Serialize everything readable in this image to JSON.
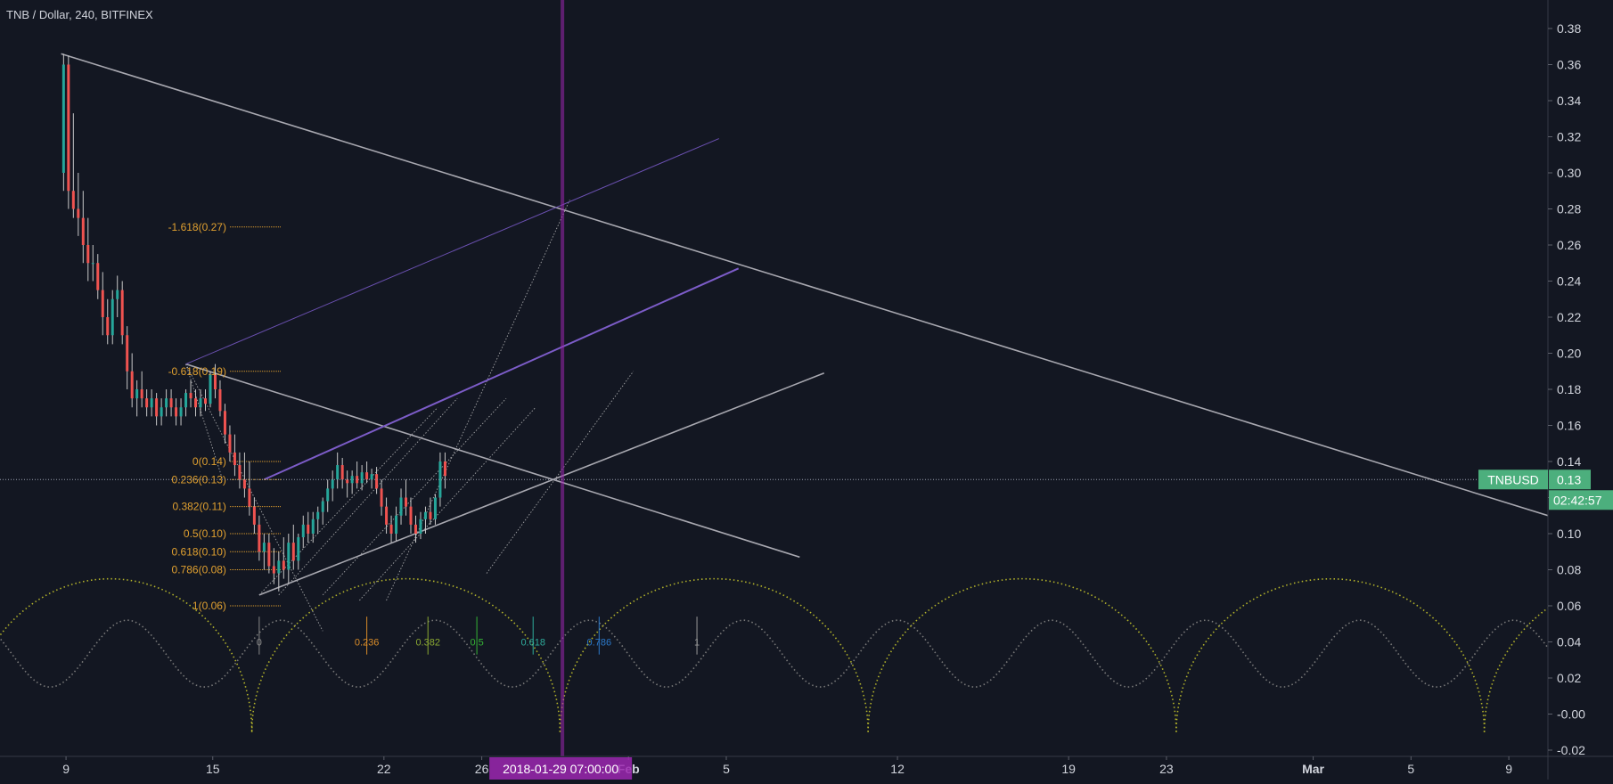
{
  "chart_data": {
    "type": "candlestick",
    "title": "TNB / Dollar, 240, BITFINEX",
    "symbol": "TNBUSD",
    "last_price": "0.13",
    "countdown": "02:42:57",
    "crosshair_date_label": "2018-01-29 07:00:00",
    "x_axis_ticks": [
      {
        "label": "9",
        "day": 9,
        "bold": false
      },
      {
        "label": "15",
        "day": 15,
        "bold": false
      },
      {
        "label": "22",
        "day": 22,
        "bold": false
      },
      {
        "label": "26",
        "day": 26,
        "bold": false
      },
      {
        "label": "Feb",
        "day": 32,
        "bold": true
      },
      {
        "label": "5",
        "day": 36,
        "bold": false
      },
      {
        "label": "12",
        "day": 43,
        "bold": false
      },
      {
        "label": "19",
        "day": 50,
        "bold": false
      },
      {
        "label": "23",
        "day": 54,
        "bold": false
      },
      {
        "label": "Mar",
        "day": 60,
        "bold": true
      },
      {
        "label": "5",
        "day": 64,
        "bold": false
      },
      {
        "label": "9",
        "day": 68,
        "bold": false
      }
    ],
    "y_axis_ticks": [
      "0.38",
      "0.36",
      "0.34",
      "0.32",
      "0.30",
      "0.28",
      "0.26",
      "0.24",
      "0.22",
      "0.20",
      "0.18",
      "0.16",
      "0.14",
      "0.12",
      "0.10",
      "0.08",
      "0.06",
      "0.04",
      "0.02",
      "-0.00",
      "-0.02"
    ],
    "y_tick_values": [
      0.38,
      0.36,
      0.34,
      0.32,
      0.3,
      0.28,
      0.26,
      0.24,
      0.22,
      0.2,
      0.18,
      0.16,
      0.14,
      0.12,
      0.1,
      0.08,
      0.06,
      0.04,
      0.02,
      0.0,
      -0.02
    ],
    "ylim": [
      -0.024,
      0.39
    ],
    "xlim": [
      6.3,
      69.6
    ],
    "crosshair": {
      "day": 29.3,
      "price": 0.13
    },
    "candles": [
      {
        "d": 8.9,
        "o": 0.3,
        "h": 0.366,
        "l": 0.29,
        "c": 0.36
      },
      {
        "d": 9.1,
        "o": 0.36,
        "h": 0.365,
        "l": 0.28,
        "c": 0.29
      },
      {
        "d": 9.3,
        "o": 0.29,
        "h": 0.333,
        "l": 0.275,
        "c": 0.28
      },
      {
        "d": 9.5,
        "o": 0.28,
        "h": 0.3,
        "l": 0.265,
        "c": 0.275
      },
      {
        "d": 9.7,
        "o": 0.275,
        "h": 0.29,
        "l": 0.25,
        "c": 0.26
      },
      {
        "d": 9.9,
        "o": 0.26,
        "h": 0.275,
        "l": 0.24,
        "c": 0.25
      },
      {
        "d": 10.1,
        "o": 0.25,
        "h": 0.26,
        "l": 0.24,
        "c": 0.25
      },
      {
        "d": 10.3,
        "o": 0.25,
        "h": 0.255,
        "l": 0.23,
        "c": 0.235
      },
      {
        "d": 10.5,
        "o": 0.235,
        "h": 0.245,
        "l": 0.21,
        "c": 0.22
      },
      {
        "d": 10.7,
        "o": 0.22,
        "h": 0.23,
        "l": 0.205,
        "c": 0.21
      },
      {
        "d": 10.9,
        "o": 0.21,
        "h": 0.235,
        "l": 0.205,
        "c": 0.23
      },
      {
        "d": 11.1,
        "o": 0.23,
        "h": 0.243,
        "l": 0.22,
        "c": 0.235
      },
      {
        "d": 11.3,
        "o": 0.235,
        "h": 0.24,
        "l": 0.205,
        "c": 0.21
      },
      {
        "d": 11.5,
        "o": 0.21,
        "h": 0.215,
        "l": 0.18,
        "c": 0.19
      },
      {
        "d": 11.7,
        "o": 0.19,
        "h": 0.2,
        "l": 0.17,
        "c": 0.175
      },
      {
        "d": 11.9,
        "o": 0.175,
        "h": 0.185,
        "l": 0.165,
        "c": 0.18
      },
      {
        "d": 12.1,
        "o": 0.18,
        "h": 0.19,
        "l": 0.17,
        "c": 0.175
      },
      {
        "d": 12.3,
        "o": 0.175,
        "h": 0.18,
        "l": 0.165,
        "c": 0.17
      },
      {
        "d": 12.5,
        "o": 0.17,
        "h": 0.18,
        "l": 0.165,
        "c": 0.175
      },
      {
        "d": 12.7,
        "o": 0.175,
        "h": 0.178,
        "l": 0.16,
        "c": 0.165
      },
      {
        "d": 12.9,
        "o": 0.165,
        "h": 0.175,
        "l": 0.16,
        "c": 0.17
      },
      {
        "d": 13.1,
        "o": 0.17,
        "h": 0.18,
        "l": 0.165,
        "c": 0.175
      },
      {
        "d": 13.3,
        "o": 0.175,
        "h": 0.18,
        "l": 0.165,
        "c": 0.17
      },
      {
        "d": 13.5,
        "o": 0.17,
        "h": 0.175,
        "l": 0.16,
        "c": 0.165
      },
      {
        "d": 13.7,
        "o": 0.165,
        "h": 0.175,
        "l": 0.16,
        "c": 0.17
      },
      {
        "d": 13.9,
        "o": 0.17,
        "h": 0.18,
        "l": 0.165,
        "c": 0.178
      },
      {
        "d": 14.1,
        "o": 0.178,
        "h": 0.185,
        "l": 0.17,
        "c": 0.175
      },
      {
        "d": 14.3,
        "o": 0.175,
        "h": 0.18,
        "l": 0.165,
        "c": 0.17
      },
      {
        "d": 14.5,
        "o": 0.17,
        "h": 0.18,
        "l": 0.165,
        "c": 0.175
      },
      {
        "d": 14.7,
        "o": 0.175,
        "h": 0.18,
        "l": 0.168,
        "c": 0.172
      },
      {
        "d": 14.9,
        "o": 0.172,
        "h": 0.19,
        "l": 0.17,
        "c": 0.188
      },
      {
        "d": 15.1,
        "o": 0.188,
        "h": 0.194,
        "l": 0.175,
        "c": 0.18
      },
      {
        "d": 15.3,
        "o": 0.18,
        "h": 0.185,
        "l": 0.165,
        "c": 0.168
      },
      {
        "d": 15.5,
        "o": 0.168,
        "h": 0.172,
        "l": 0.15,
        "c": 0.155
      },
      {
        "d": 15.7,
        "o": 0.155,
        "h": 0.16,
        "l": 0.14,
        "c": 0.145
      },
      {
        "d": 15.9,
        "o": 0.145,
        "h": 0.155,
        "l": 0.132,
        "c": 0.138
      },
      {
        "d": 16.1,
        "o": 0.138,
        "h": 0.145,
        "l": 0.125,
        "c": 0.13
      },
      {
        "d": 16.3,
        "o": 0.13,
        "h": 0.145,
        "l": 0.12,
        "c": 0.125
      },
      {
        "d": 16.5,
        "o": 0.125,
        "h": 0.14,
        "l": 0.11,
        "c": 0.115
      },
      {
        "d": 16.7,
        "o": 0.115,
        "h": 0.12,
        "l": 0.1,
        "c": 0.105
      },
      {
        "d": 16.9,
        "o": 0.105,
        "h": 0.11,
        "l": 0.085,
        "c": 0.09
      },
      {
        "d": 17.1,
        "o": 0.09,
        "h": 0.1,
        "l": 0.08,
        "c": 0.095
      },
      {
        "d": 17.3,
        "o": 0.095,
        "h": 0.1,
        "l": 0.078,
        "c": 0.082
      },
      {
        "d": 17.5,
        "o": 0.082,
        "h": 0.092,
        "l": 0.072,
        "c": 0.078
      },
      {
        "d": 17.7,
        "o": 0.078,
        "h": 0.09,
        "l": 0.068,
        "c": 0.085
      },
      {
        "d": 17.9,
        "o": 0.085,
        "h": 0.098,
        "l": 0.075,
        "c": 0.08
      },
      {
        "d": 18.1,
        "o": 0.08,
        "h": 0.1,
        "l": 0.072,
        "c": 0.095
      },
      {
        "d": 18.3,
        "o": 0.095,
        "h": 0.105,
        "l": 0.08,
        "c": 0.085
      },
      {
        "d": 18.5,
        "o": 0.085,
        "h": 0.1,
        "l": 0.08,
        "c": 0.098
      },
      {
        "d": 18.7,
        "o": 0.098,
        "h": 0.11,
        "l": 0.092,
        "c": 0.105
      },
      {
        "d": 18.9,
        "o": 0.105,
        "h": 0.112,
        "l": 0.095,
        "c": 0.1
      },
      {
        "d": 19.1,
        "o": 0.1,
        "h": 0.112,
        "l": 0.095,
        "c": 0.108
      },
      {
        "d": 19.3,
        "o": 0.108,
        "h": 0.115,
        "l": 0.1,
        "c": 0.112
      },
      {
        "d": 19.5,
        "o": 0.112,
        "h": 0.12,
        "l": 0.105,
        "c": 0.118
      },
      {
        "d": 19.7,
        "o": 0.118,
        "h": 0.13,
        "l": 0.112,
        "c": 0.125
      },
      {
        "d": 19.9,
        "o": 0.125,
        "h": 0.135,
        "l": 0.118,
        "c": 0.13
      },
      {
        "d": 20.1,
        "o": 0.13,
        "h": 0.145,
        "l": 0.125,
        "c": 0.138
      },
      {
        "d": 20.3,
        "o": 0.138,
        "h": 0.142,
        "l": 0.125,
        "c": 0.13
      },
      {
        "d": 20.5,
        "o": 0.13,
        "h": 0.135,
        "l": 0.12,
        "c": 0.128
      },
      {
        "d": 20.7,
        "o": 0.128,
        "h": 0.135,
        "l": 0.122,
        "c": 0.132
      },
      {
        "d": 20.9,
        "o": 0.132,
        "h": 0.14,
        "l": 0.125,
        "c": 0.128
      },
      {
        "d": 21.1,
        "o": 0.128,
        "h": 0.138,
        "l": 0.124,
        "c": 0.134
      },
      {
        "d": 21.3,
        "o": 0.134,
        "h": 0.14,
        "l": 0.128,
        "c": 0.13
      },
      {
        "d": 21.5,
        "o": 0.13,
        "h": 0.136,
        "l": 0.125,
        "c": 0.133
      },
      {
        "d": 21.7,
        "o": 0.133,
        "h": 0.137,
        "l": 0.122,
        "c": 0.125
      },
      {
        "d": 21.9,
        "o": 0.125,
        "h": 0.13,
        "l": 0.11,
        "c": 0.115
      },
      {
        "d": 22.1,
        "o": 0.115,
        "h": 0.12,
        "l": 0.1,
        "c": 0.105
      },
      {
        "d": 22.3,
        "o": 0.105,
        "h": 0.11,
        "l": 0.095,
        "c": 0.1
      },
      {
        "d": 22.5,
        "o": 0.1,
        "h": 0.115,
        "l": 0.096,
        "c": 0.11
      },
      {
        "d": 22.7,
        "o": 0.11,
        "h": 0.125,
        "l": 0.105,
        "c": 0.12
      },
      {
        "d": 22.9,
        "o": 0.12,
        "h": 0.13,
        "l": 0.11,
        "c": 0.115
      },
      {
        "d": 23.1,
        "o": 0.115,
        "h": 0.12,
        "l": 0.1,
        "c": 0.105
      },
      {
        "d": 23.3,
        "o": 0.105,
        "h": 0.11,
        "l": 0.095,
        "c": 0.1
      },
      {
        "d": 23.5,
        "o": 0.1,
        "h": 0.112,
        "l": 0.097,
        "c": 0.108
      },
      {
        "d": 23.7,
        "o": 0.108,
        "h": 0.115,
        "l": 0.1,
        "c": 0.112
      },
      {
        "d": 23.9,
        "o": 0.112,
        "h": 0.12,
        "l": 0.105,
        "c": 0.108
      },
      {
        "d": 24.1,
        "o": 0.108,
        "h": 0.122,
        "l": 0.105,
        "c": 0.12
      },
      {
        "d": 24.3,
        "o": 0.12,
        "h": 0.145,
        "l": 0.115,
        "c": 0.14
      },
      {
        "d": 24.5,
        "o": 0.14,
        "h": 0.145,
        "l": 0.125,
        "c": 0.132
      }
    ],
    "fibonacci_levels": [
      {
        "label": "-1.618(0.27)",
        "price": 0.27
      },
      {
        "label": "-0.618(0.19)",
        "price": 0.19
      },
      {
        "label": "0(0.14)",
        "price": 0.14
      },
      {
        "label": "0.236(0.13)",
        "price": 0.13
      },
      {
        "label": "0.382(0.11)",
        "price": 0.115
      },
      {
        "label": "0.5(0.10)",
        "price": 0.1
      },
      {
        "label": "0.618(0.10)",
        "price": 0.09
      },
      {
        "label": "0.786(0.08)",
        "price": 0.08
      },
      {
        "label": "1(0.06)",
        "price": 0.06
      }
    ],
    "fib_time_zones": [
      {
        "label": "0",
        "day": 16.9,
        "color": "#888888"
      },
      {
        "label": "0.236",
        "day": 21.3,
        "color": "#d98c28"
      },
      {
        "label": "0.382",
        "day": 23.8,
        "color": "#8aa832"
      },
      {
        "label": "0.5",
        "day": 25.8,
        "color": "#35b335"
      },
      {
        "label": "0.618",
        "day": 28.1,
        "color": "#2eaa9a"
      },
      {
        "label": "0.786",
        "day": 30.8,
        "color": "#2b78c8"
      },
      {
        "label": "1",
        "day": 34.8,
        "color": "#9a9a9a"
      }
    ],
    "trend_lines": [
      {
        "from": [
          8.8,
          0.366
        ],
        "to": [
          69.6,
          0.11
        ],
        "color": "#a8a8b0",
        "style": "solid"
      },
      {
        "from": [
          13.9,
          0.194
        ],
        "to": [
          39.0,
          0.087
        ],
        "color": "#a8a8b0",
        "style": "solid"
      },
      {
        "from": [
          16.9,
          0.066
        ],
        "to": [
          40.0,
          0.189
        ],
        "color": "#a8a8b0",
        "style": "solid"
      },
      {
        "from": [
          17.1,
          0.13
        ],
        "to": [
          36.5,
          0.247
        ],
        "color": "#7c5cc8",
        "style": "solid"
      },
      {
        "from": [
          13.9,
          0.194
        ],
        "to": [
          35.7,
          0.319
        ],
        "color": "#6a50b0",
        "style": "solid"
      }
    ],
    "fan_lines": [
      {
        "from": [
          13.9,
          0.194
        ],
        "to": [
          19.5,
          0.046
        ],
        "color": "#c8c8c8"
      },
      {
        "from": [
          16.9,
          0.066
        ],
        "to": [
          24.2,
          0.17
        ],
        "color": "#c8c8c8"
      },
      {
        "from": [
          17.7,
          0.066
        ],
        "to": [
          25.0,
          0.175
        ],
        "color": "#c8c8c8"
      },
      {
        "from": [
          19.5,
          0.066
        ],
        "to": [
          27.0,
          0.175
        ],
        "color": "#c8c8c8"
      },
      {
        "from": [
          21.0,
          0.063
        ],
        "to": [
          28.2,
          0.17
        ],
        "color": "#c8c8c8"
      },
      {
        "from": [
          22.1,
          0.063
        ],
        "to": [
          29.6,
          0.285
        ],
        "color": "#c8c8c8"
      },
      {
        "from": [
          26.2,
          0.078
        ],
        "to": [
          32.2,
          0.19
        ],
        "color": "#c8c8c8"
      },
      {
        "from": [
          13.9,
          0.194
        ],
        "to": [
          15.4,
          0.13
        ],
        "color": "#c8c8c8"
      }
    ],
    "cycle_arcs": [
      {
        "start": 5.0,
        "end": 16.6,
        "color": "#b3b32a",
        "peak": 0.075
      },
      {
        "start": 16.6,
        "end": 29.2,
        "color": "#b3b32a",
        "peak": 0.075
      },
      {
        "start": 29.2,
        "end": 41.8,
        "color": "#b3b32a",
        "peak": 0.075
      },
      {
        "start": 41.8,
        "end": 54.4,
        "color": "#b3b32a",
        "peak": 0.075
      },
      {
        "start": 54.4,
        "end": 67.0,
        "color": "#b3b32a",
        "peak": 0.075
      },
      {
        "start": 67.0,
        "end": 79.6,
        "color": "#b3b32a",
        "peak": 0.075
      }
    ],
    "sine_cycle": {
      "period": 6.3,
      "phase_day": 8.35,
      "low": 0.015,
      "high": 0.052,
      "color": "#7a7a7a"
    },
    "colors": {
      "background": "#131722",
      "up": "#26a69a",
      "down": "#ef5350",
      "crosshair": "#9c27b0",
      "price_label": "#4caf7d",
      "fib_text": "#e0a030",
      "axis_text": "#d1d4dc"
    }
  }
}
